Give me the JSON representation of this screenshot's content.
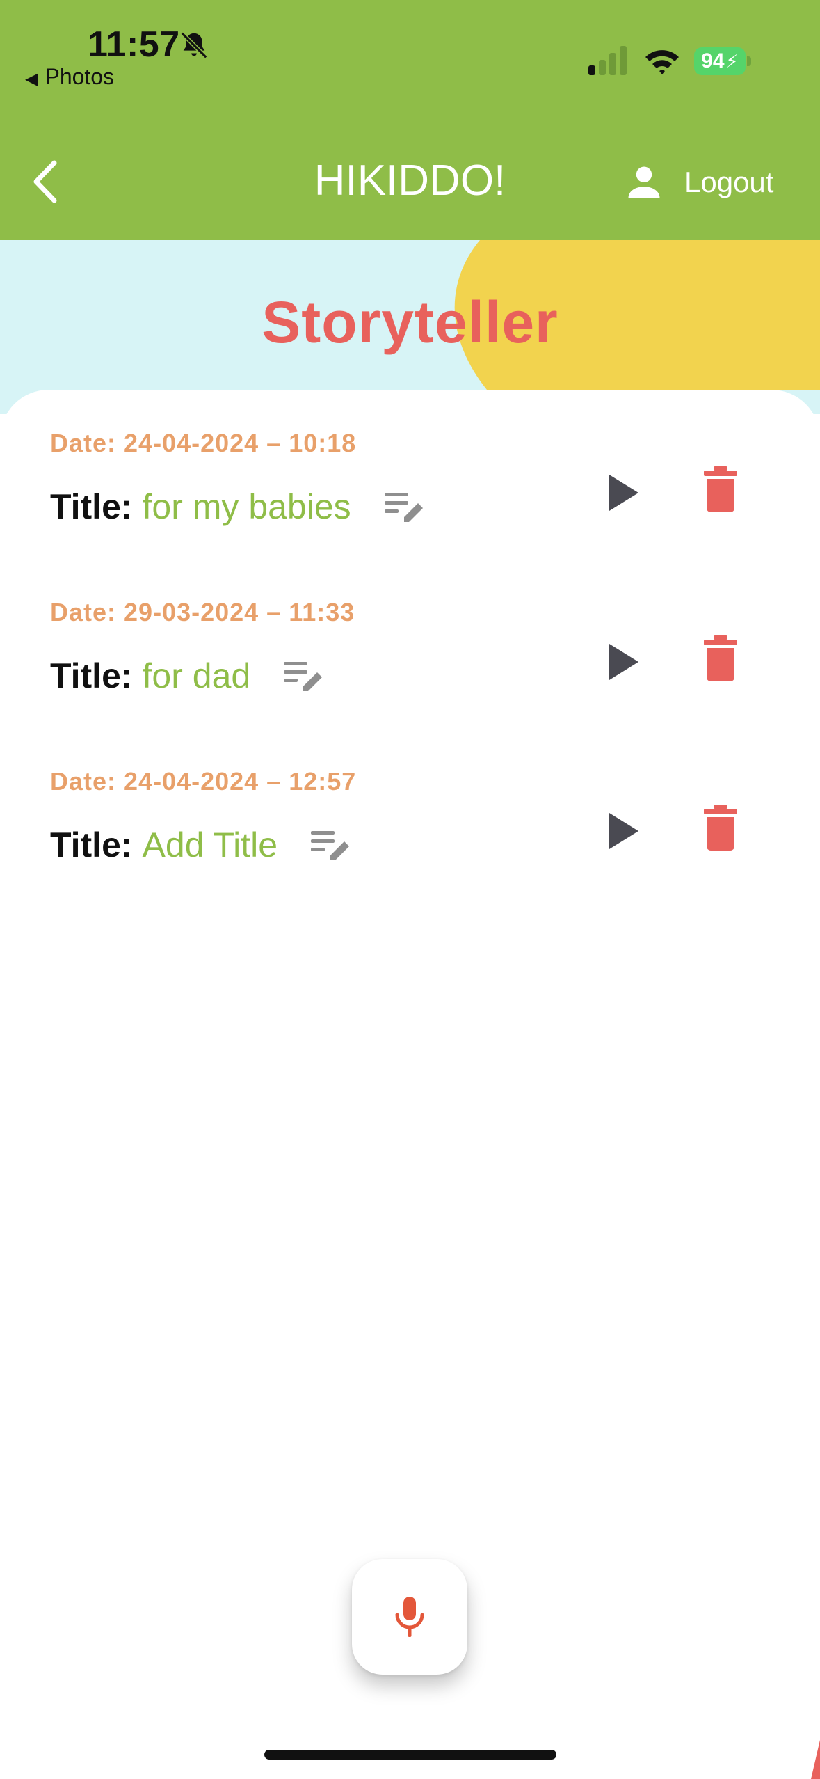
{
  "status_bar": {
    "time": "11:57",
    "back_app_label": "Photos",
    "battery_level": "94"
  },
  "app_bar": {
    "title": "HIKIDDO!",
    "logout_label": "Logout"
  },
  "page": {
    "title": "Storyteller"
  },
  "recordings": [
    {
      "date": "Date: 24-04-2024 – 10:18",
      "title_label": "Title:",
      "title_value": "for my babies"
    },
    {
      "date": "Date: 29-03-2024 – 11:33",
      "title_label": "Title:",
      "title_value": "for dad"
    },
    {
      "date": "Date: 24-04-2024 – 12:57",
      "title_label": "Title:",
      "title_value": "Add Title"
    }
  ],
  "colors": {
    "header_bg": "#8fbd48",
    "hero_bg": "#d7f4f6",
    "hero_blob": "#f2d34e",
    "accent_red": "#e8615c",
    "date_orange": "#e8a06a",
    "title_green": "#8fbd48",
    "play_dark": "#4a4a52",
    "edit_gray": "#8f8f8f"
  },
  "icons": [
    "bell-slash-icon",
    "signal-icon",
    "wifi-icon",
    "battery-icon",
    "chevron-left-icon",
    "person-icon",
    "edit-notes-icon",
    "play-icon",
    "trash-icon",
    "microphone-icon"
  ]
}
